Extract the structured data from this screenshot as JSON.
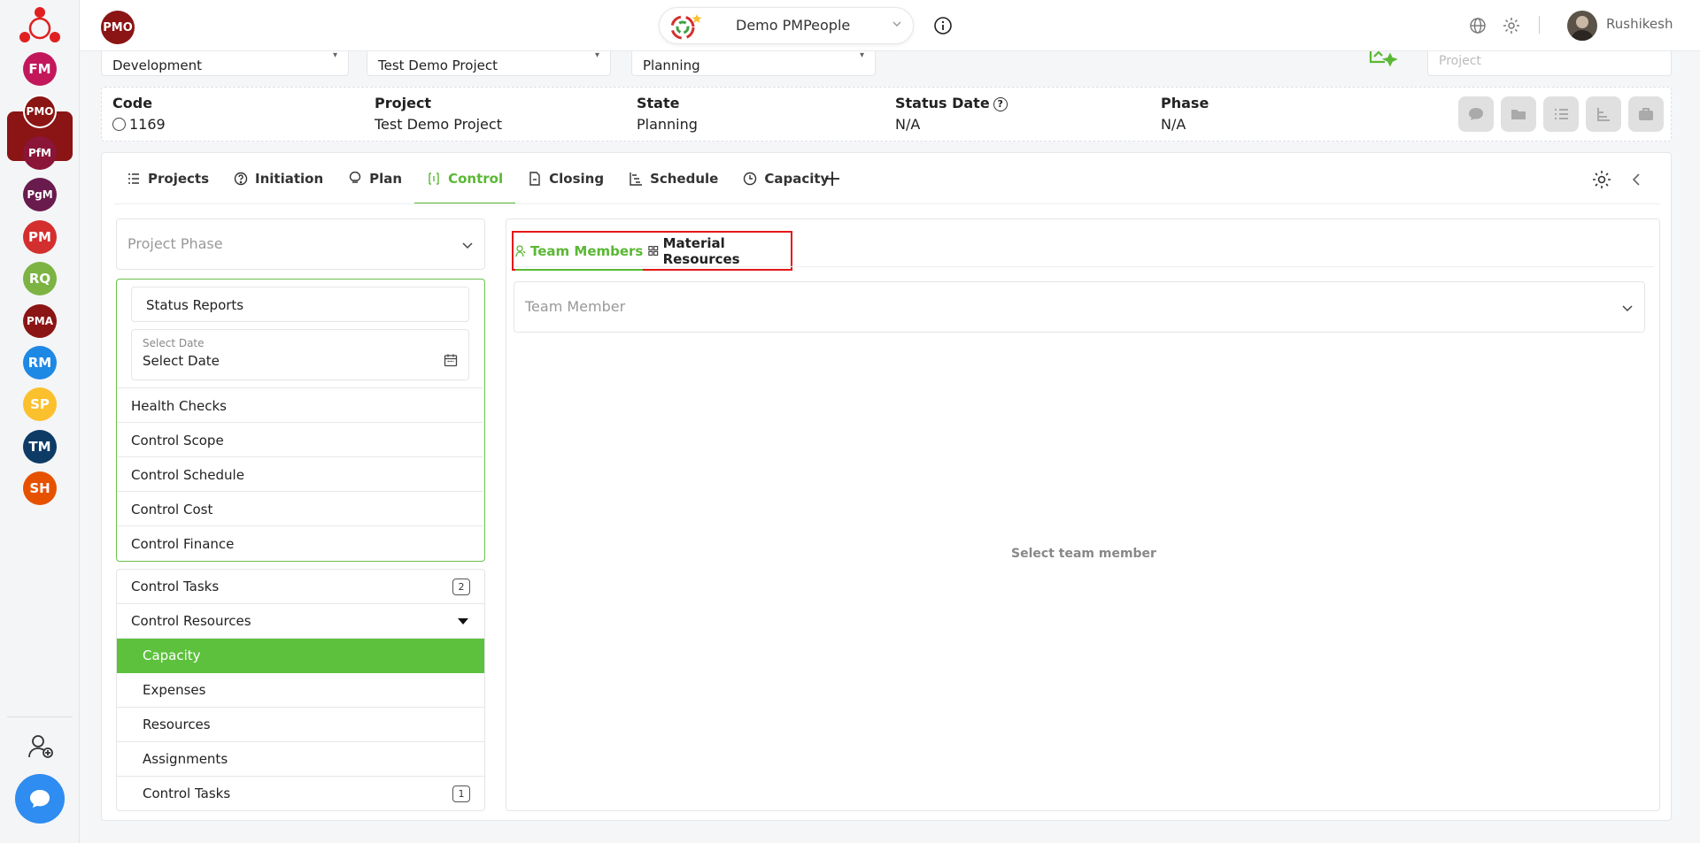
{
  "colors": {
    "brand_red": "#8b1414",
    "accent_green": "#5ab835",
    "highlight_red": "#e51818",
    "chat_blue": "#2f8cf0"
  },
  "sidebar": {
    "modules": [
      {
        "label": "FM",
        "color": "#c2185b"
      },
      {
        "label": "PMO",
        "color": "#8b1414",
        "active": true
      },
      {
        "label": "PfM",
        "color": "#8a1538"
      },
      {
        "label": "PgM",
        "color": "#6a1b4d"
      },
      {
        "label": "PM",
        "color": "#d32f2f"
      },
      {
        "label": "RQ",
        "color": "#7cb342"
      },
      {
        "label": "PMA",
        "color": "#8b1414"
      },
      {
        "label": "RM",
        "color": "#1e88e5"
      },
      {
        "label": "SP",
        "color": "#fbc02d"
      },
      {
        "label": "TM",
        "color": "#0d3b66"
      },
      {
        "label": "SH",
        "color": "#e65100"
      }
    ]
  },
  "topbar": {
    "badge": "PMO",
    "org_name": "Demo PMPeople",
    "user_name": "Rushikesh"
  },
  "filters": {
    "portfolio": "Development",
    "project": "Test Demo Project",
    "state": "Planning",
    "search_placeholder": "Project"
  },
  "info": {
    "code_label": "Code",
    "code_value": "1169",
    "project_label": "Project",
    "project_value": "Test Demo Project",
    "state_label": "State",
    "state_value": "Planning",
    "status_date_label": "Status Date",
    "status_date_value": "N/A",
    "phase_label": "Phase",
    "phase_value": "N/A"
  },
  "tabs": [
    "Projects",
    "Initiation",
    "Plan",
    "Control",
    "Closing",
    "Schedule",
    "Capacity"
  ],
  "left": {
    "phase_placeholder": "Project Phase",
    "status_reports": "Status Reports",
    "date_label": "Select Date",
    "date_value": "Select Date",
    "items": [
      "Health Checks",
      "Control Scope",
      "Control Schedule",
      "Control Cost",
      "Control Finance"
    ],
    "control_tasks": "Control Tasks",
    "control_tasks_count": "2",
    "control_resources": "Control Resources",
    "sub_items": [
      "Capacity",
      "Expenses",
      "Resources",
      "Assignments",
      "Control Tasks"
    ],
    "sub_control_tasks_count": "1"
  },
  "right": {
    "tab_team": "Team Members",
    "tab_material": "Material Resources",
    "team_member_placeholder": "Team Member",
    "empty_message": "Select team member"
  }
}
